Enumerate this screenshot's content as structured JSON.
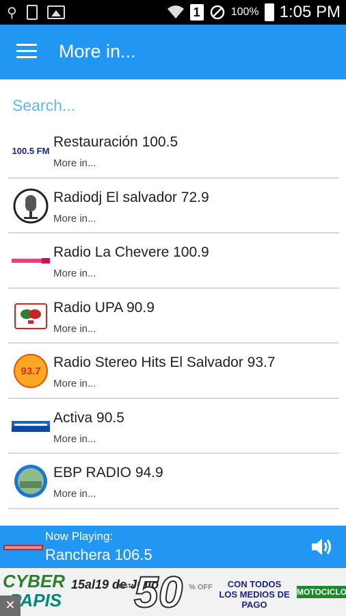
{
  "status_bar": {
    "battery_percent": "100%",
    "time": "1:05 PM",
    "sim_slot": "1",
    "icons": [
      "usb-icon",
      "sd-card-icon",
      "image-icon",
      "wifi-icon",
      "sim-icon",
      "do-not-disturb-icon",
      "battery-icon"
    ]
  },
  "toolbar": {
    "title": "More in...",
    "menu_icon": "hamburger-menu-icon",
    "color": "#2196f3"
  },
  "search": {
    "placeholder": "Search..."
  },
  "stations": [
    {
      "name": "Restauración 100.5",
      "subtitle": "More in...",
      "logo_text": "100.5 FM"
    },
    {
      "name": "Radiodj El salvador 72.9",
      "subtitle": "More in..."
    },
    {
      "name": "Radio La Chevere 100.9",
      "subtitle": "More in..."
    },
    {
      "name": "Radio UPA 90.9",
      "subtitle": "More in..."
    },
    {
      "name": "Radio Stereo Hits El Salvador 93.7",
      "subtitle": "More in...",
      "logo_text": "93.7"
    },
    {
      "name": "Activa 90.5",
      "subtitle": "More in..."
    },
    {
      "name": "EBP RADIO 94.9",
      "subtitle": "More in..."
    }
  ],
  "now_playing": {
    "label": "Now Playing:",
    "station": "Ranchera 106.5",
    "volume_icon": "volume-icon"
  },
  "ad": {
    "brand_line1": "CYBER",
    "brand_line2": "PAPIS",
    "dates": "15al19 de Julio",
    "hasta": "HASTA",
    "discount": "50",
    "off": "% OFF",
    "medios": "CON TODOS LOS MEDIOS DE PAGO",
    "partner": "MOTOCICLO",
    "close": "✕"
  }
}
